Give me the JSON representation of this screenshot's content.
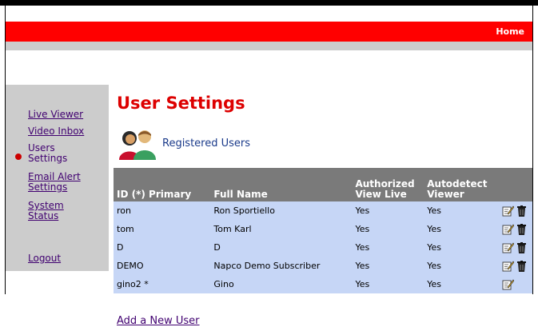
{
  "header": {
    "home_label": "Home"
  },
  "sidebar": {
    "items": [
      {
        "label": "Live Viewer"
      },
      {
        "label": "Video Inbox"
      },
      {
        "label": "Users Settings",
        "active": true
      },
      {
        "label": "Email Alert Settings"
      },
      {
        "label": "System Status"
      },
      {
        "label": "Logout"
      }
    ]
  },
  "main": {
    "title": "User Settings",
    "section_label": "Registered Users",
    "add_user_label": "Add a New User"
  },
  "table": {
    "columns": [
      "ID (*) Primary",
      "Full Name",
      "Authorized View Live",
      "Autodetect Viewer"
    ],
    "rows": [
      {
        "id": "ron",
        "name": "Ron Sportiello",
        "view_live": "Yes",
        "autodetect": "Yes",
        "deletable": true
      },
      {
        "id": "tom",
        "name": "Tom Karl",
        "view_live": "Yes",
        "autodetect": "Yes",
        "deletable": true
      },
      {
        "id": "D",
        "name": "D",
        "view_live": "Yes",
        "autodetect": "Yes",
        "deletable": true
      },
      {
        "id": "DEMO",
        "name": "Napco Demo Subscriber",
        "view_live": "Yes",
        "autodetect": "Yes",
        "deletable": true
      },
      {
        "id": "gino2 *",
        "name": "Gino",
        "view_live": "Yes",
        "autodetect": "Yes",
        "deletable": false
      }
    ]
  },
  "icons": {
    "edit": "edit-icon",
    "delete": "trash-icon",
    "users": "users-icon",
    "active_bullet": "bullet-icon"
  },
  "colors": {
    "accent": "#ff0000",
    "title": "#dd0000",
    "header_bg": "#7a7a7a",
    "row_bg": "#c6d6f6",
    "sidebar_bg": "#cccccc",
    "link": "#400070"
  }
}
